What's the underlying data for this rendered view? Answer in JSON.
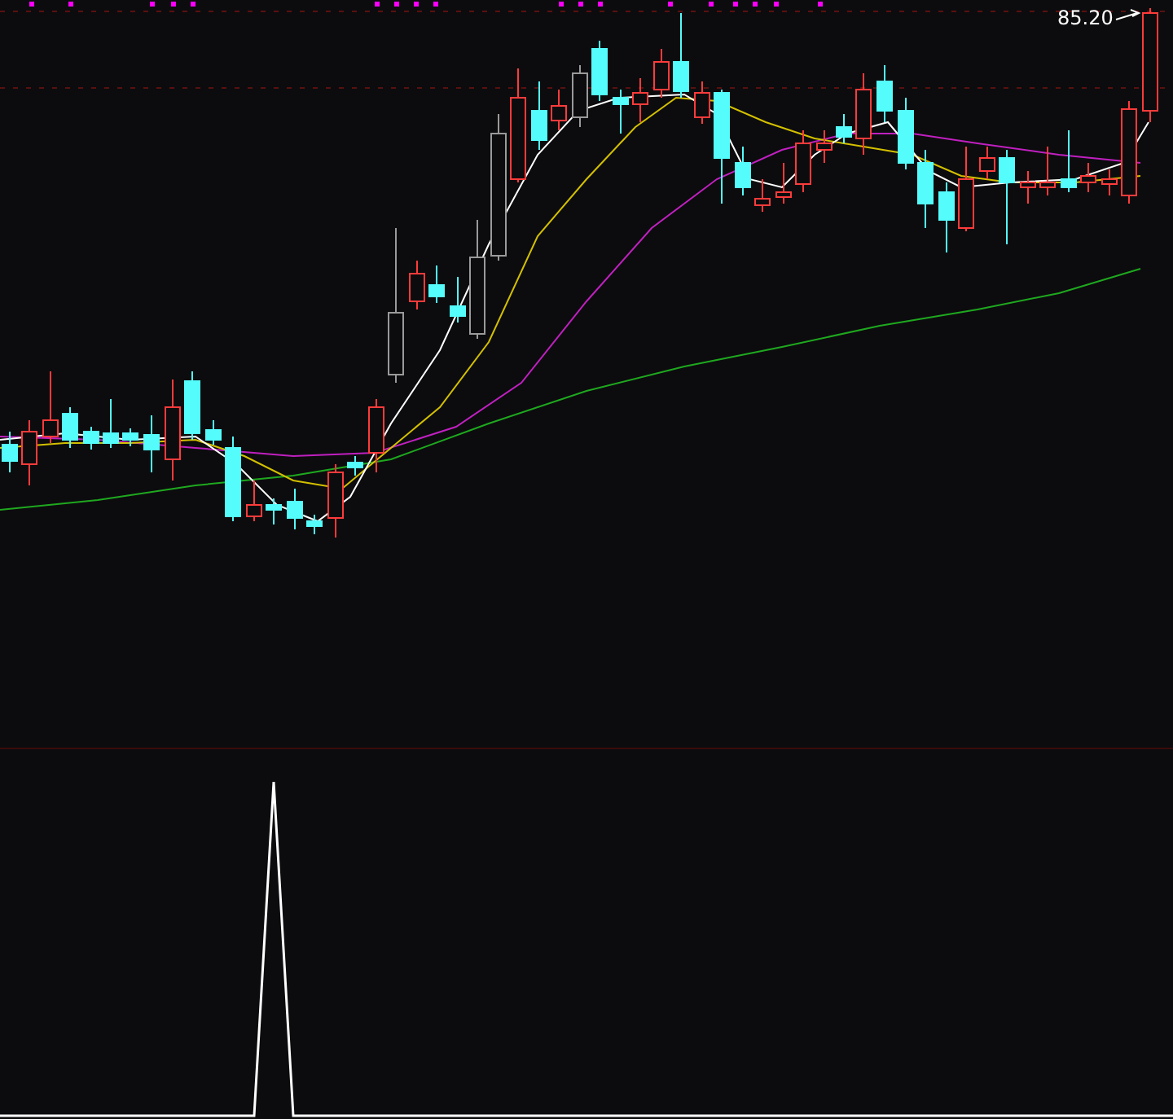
{
  "price_chart": {
    "high_price_label": "85.20"
  }
}
